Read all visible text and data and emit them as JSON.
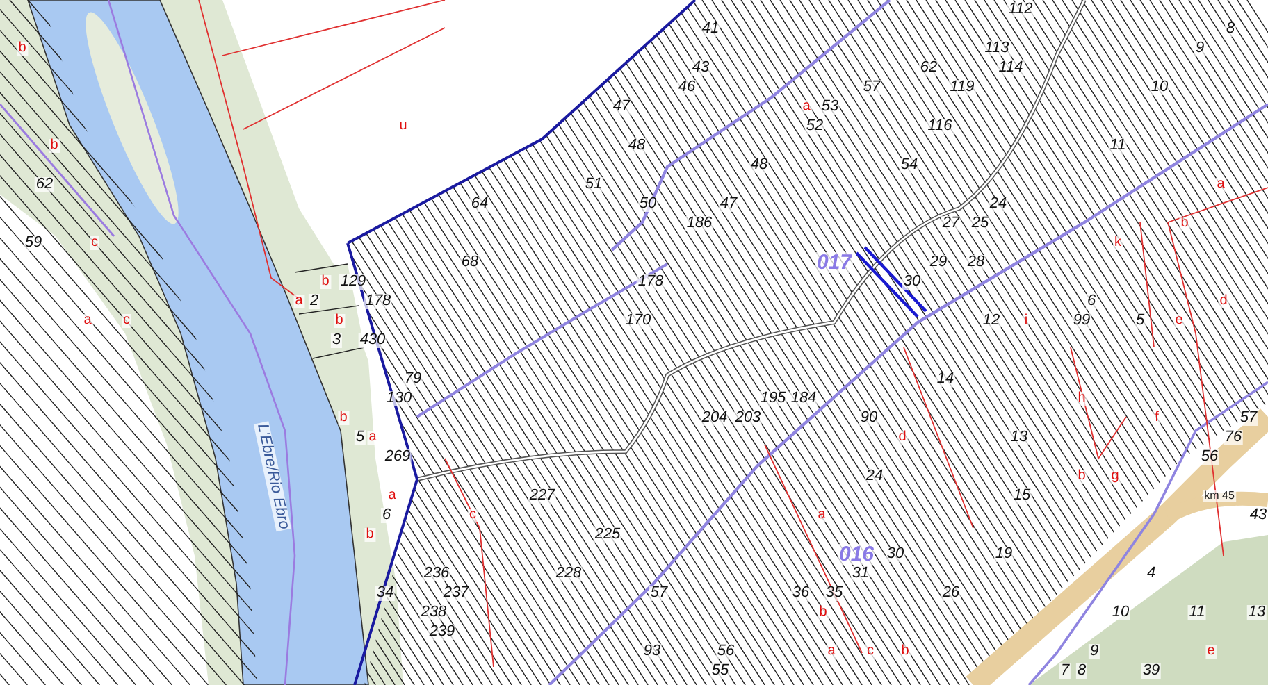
{
  "map": {
    "labels": [
      {
        "text": "112",
        "kind": "parcel"
      },
      {
        "text": "41",
        "kind": "parcel"
      },
      {
        "text": "8",
        "kind": "parcel"
      },
      {
        "text": "b",
        "kind": "subparcel"
      },
      {
        "text": "113",
        "kind": "parcel"
      },
      {
        "text": "9",
        "kind": "parcel"
      },
      {
        "text": "43",
        "kind": "parcel"
      },
      {
        "text": "62",
        "kind": "parcel"
      },
      {
        "text": "114",
        "kind": "parcel"
      },
      {
        "text": "46",
        "kind": "parcel"
      },
      {
        "text": "57",
        "kind": "parcel"
      },
      {
        "text": "119",
        "kind": "parcel"
      },
      {
        "text": "10",
        "kind": "parcel"
      },
      {
        "text": "47",
        "kind": "parcel"
      },
      {
        "text": "a",
        "kind": "subparcel"
      },
      {
        "text": "53",
        "kind": "parcel"
      },
      {
        "text": "u",
        "kind": "subparcel"
      },
      {
        "text": "52",
        "kind": "parcel"
      },
      {
        "text": "116",
        "kind": "parcel"
      },
      {
        "text": "b",
        "kind": "subparcel"
      },
      {
        "text": "48",
        "kind": "parcel"
      },
      {
        "text": "11",
        "kind": "parcel"
      },
      {
        "text": "48",
        "kind": "parcel"
      },
      {
        "text": "54",
        "kind": "parcel"
      },
      {
        "text": "62",
        "kind": "parcel"
      },
      {
        "text": "51",
        "kind": "parcel"
      },
      {
        "text": "a",
        "kind": "subparcel"
      },
      {
        "text": "64",
        "kind": "parcel"
      },
      {
        "text": "50",
        "kind": "parcel"
      },
      {
        "text": "47",
        "kind": "parcel"
      },
      {
        "text": "24",
        "kind": "parcel"
      },
      {
        "text": "186",
        "kind": "parcel"
      },
      {
        "text": "27",
        "kind": "parcel"
      },
      {
        "text": "25",
        "kind": "parcel"
      },
      {
        "text": "b",
        "kind": "subparcel"
      },
      {
        "text": "59",
        "kind": "parcel"
      },
      {
        "text": "c",
        "kind": "subparcel"
      },
      {
        "text": "k",
        "kind": "subparcel"
      },
      {
        "text": "68",
        "kind": "parcel"
      },
      {
        "text": "017",
        "kind": "zone"
      },
      {
        "text": "29",
        "kind": "parcel"
      },
      {
        "text": "28",
        "kind": "parcel"
      },
      {
        "text": "b",
        "kind": "subparcel"
      },
      {
        "text": "129",
        "kind": "parcel"
      },
      {
        "text": "178",
        "kind": "parcel"
      },
      {
        "text": "30",
        "kind": "parcel"
      },
      {
        "text": "a",
        "kind": "subparcel"
      },
      {
        "text": "2",
        "kind": "parcel"
      },
      {
        "text": "178",
        "kind": "parcel"
      },
      {
        "text": "6",
        "kind": "parcel"
      },
      {
        "text": "d",
        "kind": "subparcel"
      },
      {
        "text": "a",
        "kind": "subparcel"
      },
      {
        "text": "c",
        "kind": "subparcel"
      },
      {
        "text": "b",
        "kind": "subparcel"
      },
      {
        "text": "170",
        "kind": "parcel"
      },
      {
        "text": "12",
        "kind": "parcel"
      },
      {
        "text": "i",
        "kind": "subparcel"
      },
      {
        "text": "99",
        "kind": "parcel"
      },
      {
        "text": "5",
        "kind": "parcel"
      },
      {
        "text": "e",
        "kind": "subparcel"
      },
      {
        "text": "3",
        "kind": "parcel"
      },
      {
        "text": "430",
        "kind": "parcel"
      },
      {
        "text": "79",
        "kind": "parcel"
      },
      {
        "text": "14",
        "kind": "parcel"
      },
      {
        "text": "130",
        "kind": "parcel"
      },
      {
        "text": "195",
        "kind": "parcel"
      },
      {
        "text": "184",
        "kind": "parcel"
      },
      {
        "text": "h",
        "kind": "subparcel"
      },
      {
        "text": "b",
        "kind": "subparcel"
      },
      {
        "text": "204",
        "kind": "parcel"
      },
      {
        "text": "203",
        "kind": "parcel"
      },
      {
        "text": "90",
        "kind": "parcel"
      },
      {
        "text": "f",
        "kind": "subparcel"
      },
      {
        "text": "57",
        "kind": "parcel"
      },
      {
        "text": "5",
        "kind": "parcel"
      },
      {
        "text": "a",
        "kind": "subparcel"
      },
      {
        "text": "d",
        "kind": "subparcel"
      },
      {
        "text": "13",
        "kind": "parcel"
      },
      {
        "text": "76",
        "kind": "parcel"
      },
      {
        "text": "269",
        "kind": "parcel"
      },
      {
        "text": "56",
        "kind": "parcel"
      },
      {
        "text": "L'Ebre/Rio Ebro",
        "kind": "river"
      },
      {
        "text": "24",
        "kind": "parcel"
      },
      {
        "text": "b",
        "kind": "subparcel"
      },
      {
        "text": "g",
        "kind": "subparcel"
      },
      {
        "text": "a",
        "kind": "subparcel"
      },
      {
        "text": "227",
        "kind": "parcel"
      },
      {
        "text": "15",
        "kind": "parcel"
      },
      {
        "text": "km 45",
        "kind": "road"
      },
      {
        "text": "6",
        "kind": "parcel"
      },
      {
        "text": "c",
        "kind": "subparcel"
      },
      {
        "text": "a",
        "kind": "subparcel"
      },
      {
        "text": "43",
        "kind": "parcel"
      },
      {
        "text": "b",
        "kind": "subparcel"
      },
      {
        "text": "225",
        "kind": "parcel"
      },
      {
        "text": "016",
        "kind": "zone"
      },
      {
        "text": "30",
        "kind": "parcel"
      },
      {
        "text": "19",
        "kind": "parcel"
      },
      {
        "text": "236",
        "kind": "parcel"
      },
      {
        "text": "228",
        "kind": "parcel"
      },
      {
        "text": "31",
        "kind": "parcel"
      },
      {
        "text": "4",
        "kind": "parcel"
      },
      {
        "text": "34",
        "kind": "parcel"
      },
      {
        "text": "237",
        "kind": "parcel"
      },
      {
        "text": "57",
        "kind": "parcel"
      },
      {
        "text": "36",
        "kind": "parcel"
      },
      {
        "text": "35",
        "kind": "parcel"
      },
      {
        "text": "26",
        "kind": "parcel"
      },
      {
        "text": "238",
        "kind": "parcel"
      },
      {
        "text": "b",
        "kind": "subparcel"
      },
      {
        "text": "10",
        "kind": "parcel"
      },
      {
        "text": "11",
        "kind": "parcel"
      },
      {
        "text": "13",
        "kind": "parcel"
      },
      {
        "text": "239",
        "kind": "parcel"
      },
      {
        "text": "93",
        "kind": "parcel"
      },
      {
        "text": "56",
        "kind": "parcel"
      },
      {
        "text": "a",
        "kind": "subparcel"
      },
      {
        "text": "c",
        "kind": "subparcel"
      },
      {
        "text": "b",
        "kind": "subparcel"
      },
      {
        "text": "9",
        "kind": "parcel"
      },
      {
        "text": "e",
        "kind": "subparcel"
      },
      {
        "text": "55",
        "kind": "parcel"
      },
      {
        "text": "7",
        "kind": "parcel"
      },
      {
        "text": "8",
        "kind": "parcel"
      },
      {
        "text": "39",
        "kind": "parcel"
      }
    ]
  }
}
